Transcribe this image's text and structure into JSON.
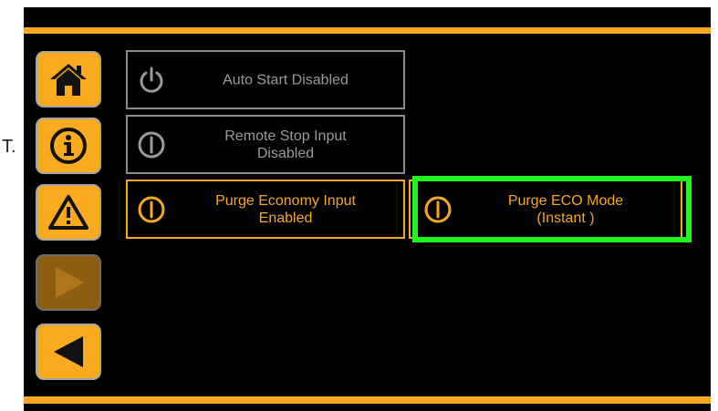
{
  "stray_text": "T.",
  "sidebar": {
    "home": "home-icon",
    "info": "info-icon",
    "warning": "warning-icon",
    "play": "play-icon",
    "back": "back-arrow-icon"
  },
  "tiles": [
    {
      "label": "Auto Start Disabled",
      "icon": "power-icon",
      "state": "disabled"
    },
    {
      "label": "Remote Stop Input\nDisabled",
      "icon": "toggle-off-icon",
      "state": "disabled"
    },
    {
      "label": "Purge Economy Input\nEnabled",
      "icon": "toggle-off-icon",
      "state": "enabled"
    },
    {
      "label": "Purge ECO Mode\n(Instant )",
      "icon": "toggle-off-icon",
      "state": "enabled"
    }
  ],
  "colors": {
    "accent": "#f7a823",
    "highlight": "#1ff51f",
    "disabled_text": "#9a9a9a",
    "background": "#000000"
  }
}
